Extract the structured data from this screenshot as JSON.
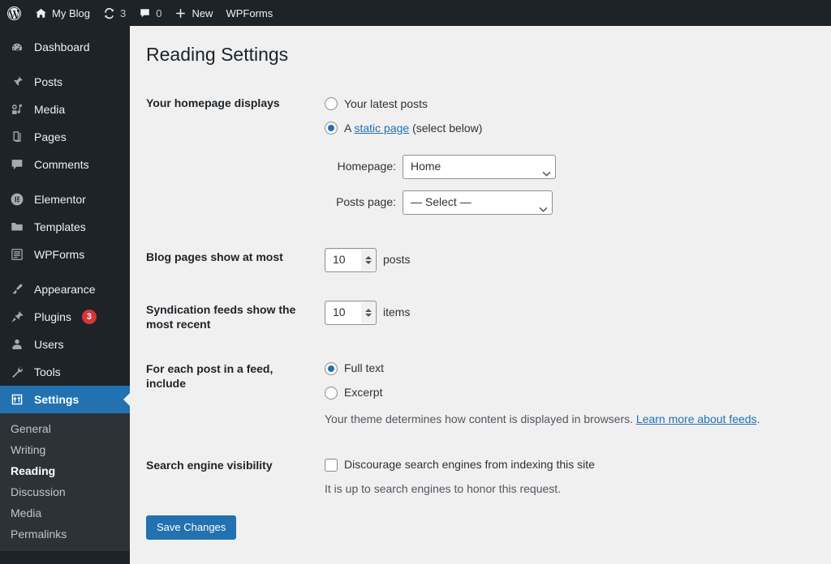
{
  "adminbar": {
    "logo_icon": "wordpress-logo-icon",
    "site_name": "My Blog",
    "site_icon": "home-icon",
    "updates_icon": "update-icon",
    "updates_count": "3",
    "comments_icon": "comment-bubble-icon",
    "comments_count": "0",
    "new_icon": "plus-icon",
    "new_label": "New",
    "wpforms_label": "WPForms"
  },
  "sidebar": {
    "items": [
      {
        "label": "Dashboard",
        "icon": "dashboard-gauge-icon",
        "badge": null
      },
      {
        "label": "Posts",
        "icon": "pushpin-icon",
        "badge": null
      },
      {
        "label": "Media",
        "icon": "media-music-icon",
        "badge": null
      },
      {
        "label": "Pages",
        "icon": "pages-icon",
        "badge": null
      },
      {
        "label": "Comments",
        "icon": "comment-bubble-icon",
        "badge": null
      },
      {
        "label": "Elementor",
        "icon": "elementor-circle-icon",
        "badge": null
      },
      {
        "label": "Templates",
        "icon": "folder-icon",
        "badge": null
      },
      {
        "label": "WPForms",
        "icon": "form-list-icon",
        "badge": null
      },
      {
        "label": "Appearance",
        "icon": "paintbrush-icon",
        "badge": null
      },
      {
        "label": "Plugins",
        "icon": "plug-icon",
        "badge": "3"
      },
      {
        "label": "Users",
        "icon": "user-icon",
        "badge": null
      },
      {
        "label": "Tools",
        "icon": "wrench-icon",
        "badge": null
      },
      {
        "label": "Settings",
        "icon": "settings-sliders-icon",
        "badge": null
      }
    ],
    "submenu": [
      {
        "label": "General"
      },
      {
        "label": "Writing"
      },
      {
        "label": "Reading"
      },
      {
        "label": "Discussion"
      },
      {
        "label": "Media"
      },
      {
        "label": "Permalinks"
      }
    ]
  },
  "page": {
    "title": "Reading Settings"
  },
  "homepage_section": {
    "label": "Your homepage displays",
    "option_latest": "Your latest posts",
    "option_static_prefix": "A ",
    "option_static_link": "static page",
    "option_static_suffix": " (select below)",
    "homepage_label": "Homepage:",
    "homepage_value": "Home",
    "postspage_label": "Posts page:",
    "postspage_value": "— Select —"
  },
  "blog_pages_section": {
    "label": "Blog pages show at most",
    "value": "10",
    "unit": "posts"
  },
  "syndication_section": {
    "label": "Syndication feeds show the most recent",
    "value": "10",
    "unit": "items"
  },
  "feed_content_section": {
    "label": "For each post in a feed, include",
    "option_full": "Full text",
    "option_excerpt": "Excerpt",
    "help_prefix": "Your theme determines how content is displayed in browsers. ",
    "help_link": "Learn more about feeds",
    "help_suffix": "."
  },
  "search_visibility_section": {
    "label": "Search engine visibility",
    "checkbox_label": "Discourage search engines from indexing this site",
    "help": "It is up to search engines to honor this request."
  },
  "submit": {
    "save_label": "Save Changes"
  },
  "colors": {
    "accent": "#2271b1",
    "sidebar_bg": "#1d2327",
    "submenu_bg": "#2c3338",
    "content_bg": "#f0f0f1",
    "badge_red": "#d63638"
  }
}
